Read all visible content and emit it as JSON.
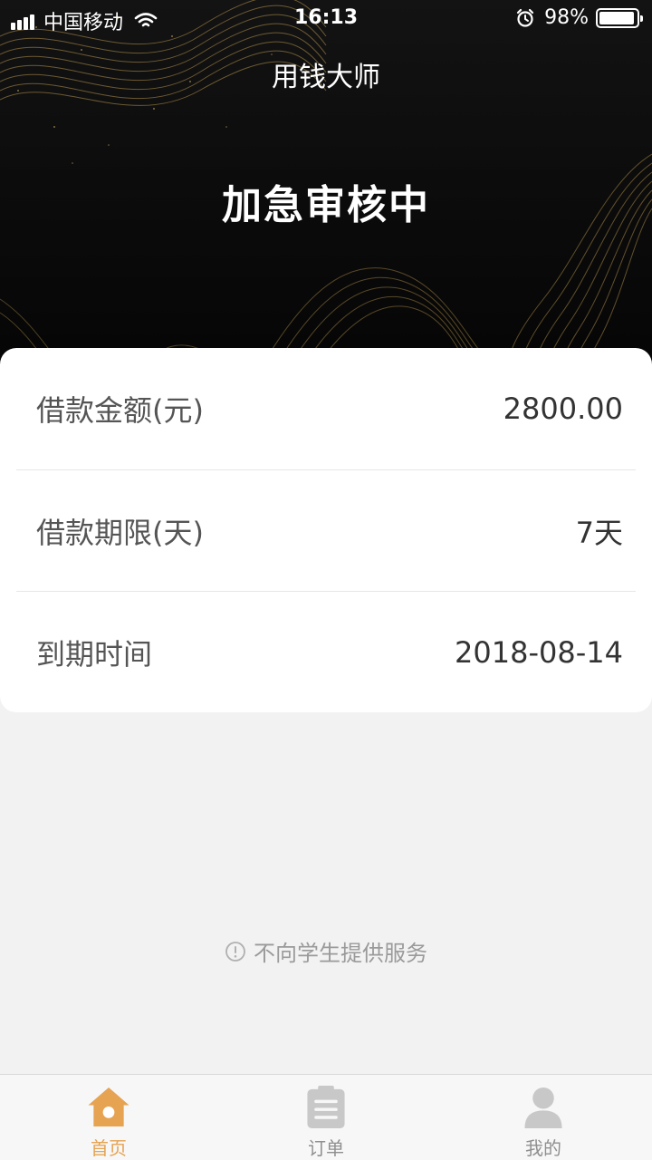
{
  "status_bar": {
    "carrier": "中国移动",
    "time": "16:13",
    "battery": "98%"
  },
  "header": {
    "app_title": "用钱大师",
    "status_title": "加急审核中"
  },
  "loan_details": [
    {
      "label": "借款金额(元)",
      "value": "2800.00"
    },
    {
      "label": "借款期限(天)",
      "value": "7天"
    },
    {
      "label": "到期时间",
      "value": "2018-08-14"
    }
  ],
  "notice": {
    "text": "不向学生提供服务",
    "icon": "info-icon"
  },
  "tabbar": {
    "items": [
      {
        "label": "首页",
        "icon": "home-icon",
        "active": true
      },
      {
        "label": "订单",
        "icon": "clipboard-icon",
        "active": false
      },
      {
        "label": "我的",
        "icon": "user-icon",
        "active": false
      }
    ]
  },
  "colors": {
    "accent": "#e6a352",
    "hero_bg": "#0b0b0b",
    "gold_lines": "#b8964e",
    "page_bg": "#f2f2f2"
  }
}
